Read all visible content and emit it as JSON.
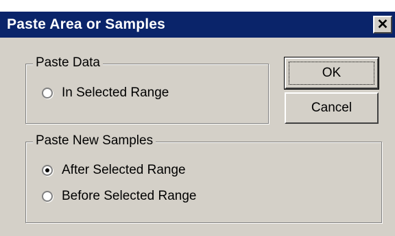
{
  "window": {
    "title": "Paste Area or Samples",
    "close_label": "✕"
  },
  "paste_data": {
    "label": "Paste Data",
    "options": [
      {
        "label": "In Selected Range",
        "selected": false
      }
    ]
  },
  "paste_new_samples": {
    "label": "Paste New Samples",
    "options": [
      {
        "label": "After Selected Range",
        "selected": true
      },
      {
        "label": "Before Selected Range",
        "selected": false
      }
    ]
  },
  "buttons": {
    "ok": "OK",
    "cancel": "Cancel"
  },
  "colors": {
    "titlebar": "#0a246a",
    "face": "#d4d0c8"
  }
}
